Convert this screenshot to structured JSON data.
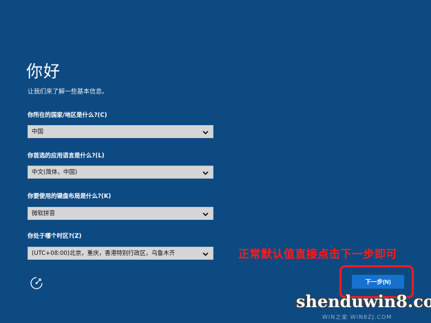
{
  "page": {
    "title": "你好",
    "subtitle": "让我们来了解一些基本信息。"
  },
  "form": {
    "country": {
      "label": "你所在的国家/地区是什么?(C)",
      "value": "中国"
    },
    "language": {
      "label": "你首选的应用语言是什么?(L)",
      "value": "中文(简体，中国)"
    },
    "keyboard": {
      "label": "你要使用的键盘布局是什么?(K)",
      "value": "微软拼音"
    },
    "timezone": {
      "label": "你处于哪个时区?(Z)",
      "value": "(UTC+08:00)北京，重庆，香港特别行政区，乌鲁木齐"
    }
  },
  "actions": {
    "next_label": "下一步(N)"
  },
  "annotation": {
    "text": "正常默认值直接点击下一步即可",
    "color": "#ff1a1a"
  },
  "watermark": {
    "main": "shenduwin8.com",
    "sub": "WIN之家 WIN8ZJ.COM"
  },
  "icons": {
    "ease_of_access": "ease-of-access-icon",
    "dropdown": "chevron-down-icon"
  },
  "colors": {
    "background": "#0e4a82",
    "button": "#1671cf",
    "dropdown_bg": "#d6d6d6"
  }
}
